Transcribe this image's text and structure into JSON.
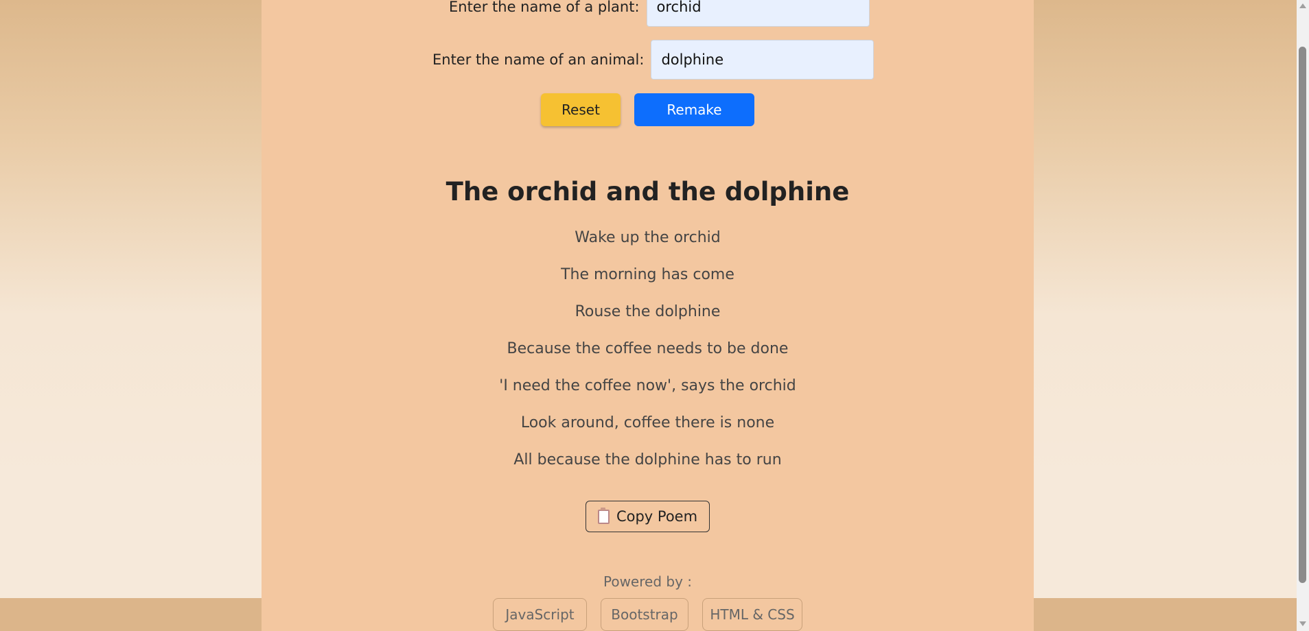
{
  "form": {
    "plant_label": "Enter the name of a plant:",
    "plant_value": "orchid",
    "animal_label": "Enter the name of an animal:",
    "animal_value": "dolphine"
  },
  "buttons": {
    "reset_label": "Reset",
    "remake_label": "Remake",
    "copy_label": "Copy Poem"
  },
  "poem": {
    "title": "The orchid and the dolphine",
    "lines": [
      "Wake up the orchid",
      "The morning has come",
      "Rouse the dolphine",
      "Because the coffee needs to be done",
      "'I need the coffee now', says the orchid",
      "Look around, coffee there is none",
      "All because the dolphine has to run"
    ]
  },
  "footer": {
    "powered_by": "Powered by :",
    "technologies": [
      "JavaScript",
      "Bootstrap",
      "HTML & CSS"
    ]
  },
  "icons": {
    "copy": "clipboard-icon"
  },
  "colors": {
    "card_background": "#f3c7a0",
    "reset_button": "#f6c132",
    "remake_button": "#0d6efd",
    "input_background": "#e8f0fe"
  }
}
